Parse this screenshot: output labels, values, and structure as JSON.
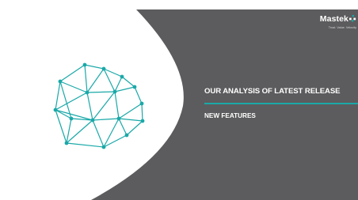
{
  "slide": {
    "title": "OUR ANALYSIS OF LATEST RELEASE",
    "subtitle": "NEW FEATURES"
  },
  "logo": {
    "name": "Mastek",
    "tagline": "Trust. Value. Velocity"
  },
  "colors": {
    "panel": "#5c5c5e",
    "accent": "#1aa8a8",
    "background": "#ffffff",
    "text": "#ffffff"
  },
  "icons": {
    "network": "network-globe-icon",
    "logo_mark": "mastek-star-icon"
  }
}
